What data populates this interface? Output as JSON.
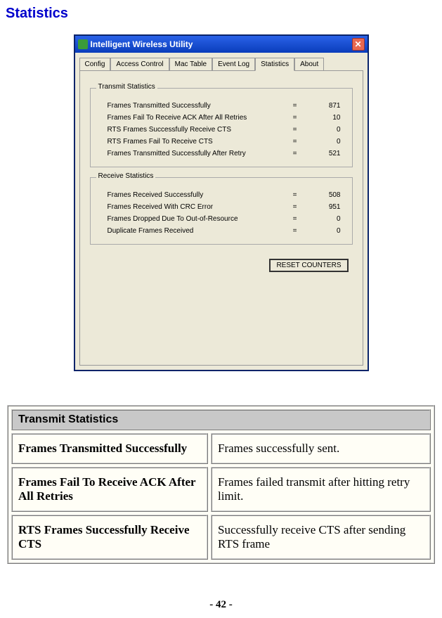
{
  "page_title": "Statistics",
  "window": {
    "title": "Intelligent Wireless Utility",
    "tabs": [
      "Config",
      "Access Control",
      "Mac Table",
      "Event Log",
      "Statistics",
      "About"
    ],
    "active_tab": "Statistics",
    "transmit": {
      "title": "Transmit Statistics",
      "rows": [
        {
          "label": "Frames Transmitted Successfully",
          "value": "871"
        },
        {
          "label": "Frames Fail To Receive ACK After All Retries",
          "value": "10"
        },
        {
          "label": "RTS Frames Successfully Receive CTS",
          "value": "0"
        },
        {
          "label": "RTS Frames Fail To Receive CTS",
          "value": "0"
        },
        {
          "label": "Frames Transmitted Successfully After Retry",
          "value": "521"
        }
      ]
    },
    "receive": {
      "title": "Receive Statistics",
      "rows": [
        {
          "label": "Frames Received Successfully",
          "value": "508"
        },
        {
          "label": "Frames Received With CRC Error",
          "value": "951"
        },
        {
          "label": "Frames Dropped Due To Out-of-Resource",
          "value": "0"
        },
        {
          "label": "Duplicate Frames Received",
          "value": "0"
        }
      ]
    },
    "reset_button": "RESET COUNTERS"
  },
  "definitions": {
    "header": "Transmit Statistics",
    "rows": [
      {
        "term": "Frames Transmitted Successfully",
        "desc": "Frames successfully sent."
      },
      {
        "term": "Frames Fail To Receive ACK After All Retries",
        "desc": "Frames failed transmit after hitting retry limit."
      },
      {
        "term": "RTS Frames Successfully Receive CTS",
        "desc": "Successfully receive CTS after sending RTS frame"
      }
    ]
  },
  "page_number": "- 42 -"
}
